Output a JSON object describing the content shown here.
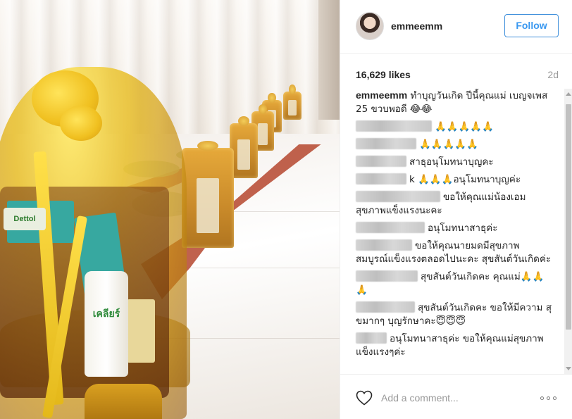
{
  "post": {
    "username": "emmeemm",
    "follow_label": "Follow",
    "likes": "16,629 likes",
    "time_ago": "2d",
    "add_comment_placeholder": "Add a comment...",
    "photo_label_bottle": "เคลียร์",
    "photo_label_dettol": "Dettol"
  },
  "comments": [
    {
      "author": "emmeemm",
      "text": "ทำบุญวันเกิด ปีนี้คุณแม่ เบญจเพส 25 ขวบพอดี 😂😂",
      "blurred": false
    },
    {
      "author": "",
      "text": "🙏🙏🙏🙏🙏",
      "blurred": true,
      "blur_width": 108
    },
    {
      "author": "",
      "text": "🙏🙏🙏🙏🙏",
      "blurred": true,
      "blur_width": 86
    },
    {
      "author": "",
      "text": "สาธุอนุโมทนาบุญคะ",
      "blurred": true,
      "blur_width": 72
    },
    {
      "author": "",
      "text": "k 🙏🙏🙏อนุโมทนาบุญค่ะ",
      "blurred": true,
      "blur_width": 72
    },
    {
      "author": "",
      "text": "ขอให้คุณแม่น้องเอม สุขภาพแข็งแรงนะคะ",
      "blurred": true,
      "blur_width": 120
    },
    {
      "author": "",
      "text": "อนุโมทนาสาธุค่ะ",
      "blurred": true,
      "blur_width": 98
    },
    {
      "author": "",
      "text": "ขอให้คุณนายมดมีสุขภาพ สมบูรณ์แข็งแรงตลอดไปนะคะ สุขสันต์วันเกิดค่ะ",
      "blurred": true,
      "blur_width": 80
    },
    {
      "author": "",
      "text": "สุขสันต์วันเกิดคะ คุณแม่🙏🙏 🙏",
      "blurred": true,
      "blur_width": 88
    },
    {
      "author": "",
      "text": "สุขสันต์วันเกิดคะ ขอให้มีความ สุขมากๆ บุญรักษาคะ😇😇😇",
      "blurred": true,
      "blur_width": 84
    },
    {
      "author": "",
      "text": "อนุโมทนาสาธุค่ะ ขอให้คุณแม่สุขภาพ แข็งแรงๆค่ะ",
      "blurred": true,
      "blur_width": 44
    }
  ],
  "icons": {
    "heart": "heart-outline-icon",
    "more": "more-dots-icon"
  },
  "colors": {
    "follow_text": "#3897f0",
    "follow_border": "#4090db",
    "muted": "#999999"
  }
}
